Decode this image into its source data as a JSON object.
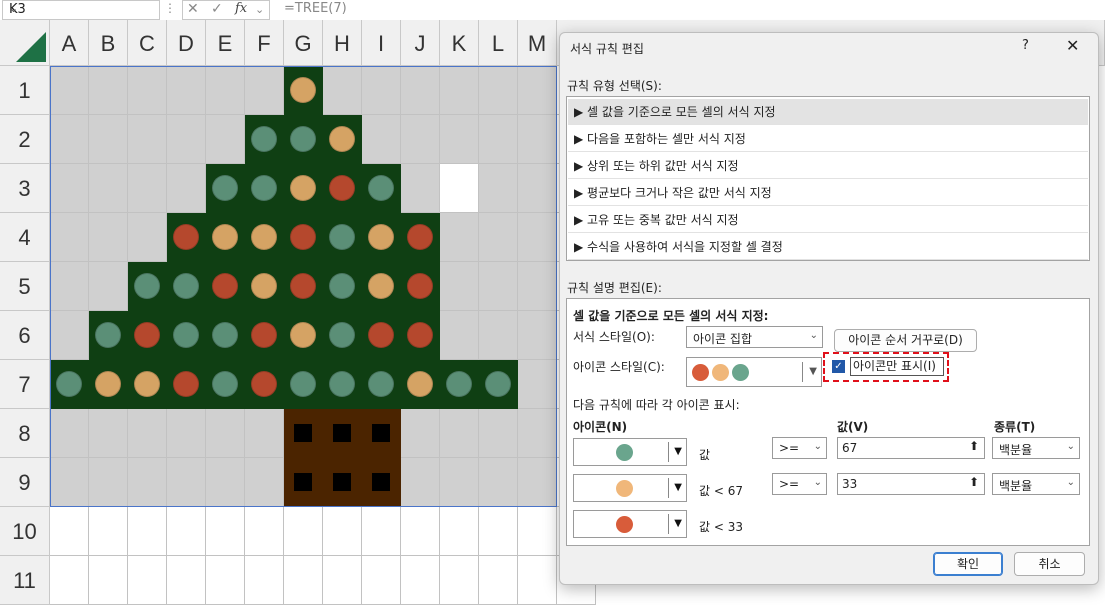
{
  "formula_bar": {
    "name_box": "K3",
    "formula": "=TREE(7)"
  },
  "columns": [
    "A",
    "B",
    "C",
    "D",
    "E",
    "F",
    "G",
    "H",
    "I",
    "J",
    "K",
    "L",
    "M"
  ],
  "rows": [
    "1",
    "2",
    "3",
    "4",
    "5",
    "6",
    "7",
    "8",
    "9",
    "10",
    "11"
  ],
  "tree_map": [
    "......o......",
    ".....ggo.....",
    "....gGoRg.W..",
    "...RooRgoR...",
    "..ggRoRgoR...",
    ".gRggRogRR...",
    "gooRgRgGgogg.",
    "......TTT....",
    "......TTT....",
    ".............",
    "............."
  ],
  "colors": {
    "background_cell": "#d0d0d0",
    "tree_green": "#0f3f13",
    "trunk_brown": "#4b2400",
    "white_cell": "#ffffff",
    "icon_green": "#5b8f77",
    "icon_orange": "#d5a364",
    "icon_red": "#b5482d",
    "dialog_icon_green": "#6aa58d",
    "dialog_icon_orange": "#f0b77a",
    "dialog_icon_red": "#d85c3a"
  },
  "dialog": {
    "title": "서식 규칙 편집",
    "help": "?",
    "close": "✕",
    "rule_type_label": "규칙 유형 선택(S):",
    "rule_types": [
      "▶ 셀 값을 기준으로 모든 셀의 서식 지정",
      "▶ 다음을 포함하는 셀만 서식 지정",
      "▶ 상위 또는 하위 값만 서식 지정",
      "▶ 평균보다 크거나 작은 값만 서식 지정",
      "▶ 고유 또는 중복 값만 서식 지정",
      "▶ 수식을 사용하여 서식을 지정할 셀 결정"
    ],
    "edit_label": "규칙 설명 편집(E):",
    "desc_title": "셀 값을 기준으로 모든 셀의 서식 지정:",
    "format_style_label": "서식 스타일(O):",
    "format_style_value": "아이콘 집합",
    "reverse_button": "아이콘 순서 거꾸로(D)",
    "icon_style_label": "아이콘 스타일(C):",
    "show_icon_only_label": "아이콘만 표시(I)",
    "show_icon_only_checked": true,
    "display_rule_label": "다음 규칙에 따라 각 아이콘 표시:",
    "col_icon": "아이콘(N)",
    "col_value": "값(V)",
    "col_type": "종류(T)",
    "icon_rules": [
      {
        "condition": "값",
        "operator": ">=",
        "value": "67",
        "type": "백분율",
        "color": "#6aa58d"
      },
      {
        "condition": "값 < 67",
        "operator": ">=",
        "value": "33",
        "type": "백분율",
        "color": "#f0b77a"
      },
      {
        "condition": "값 < 33",
        "color": "#d85c3a"
      }
    ],
    "ok": "확인",
    "cancel": "취소"
  }
}
